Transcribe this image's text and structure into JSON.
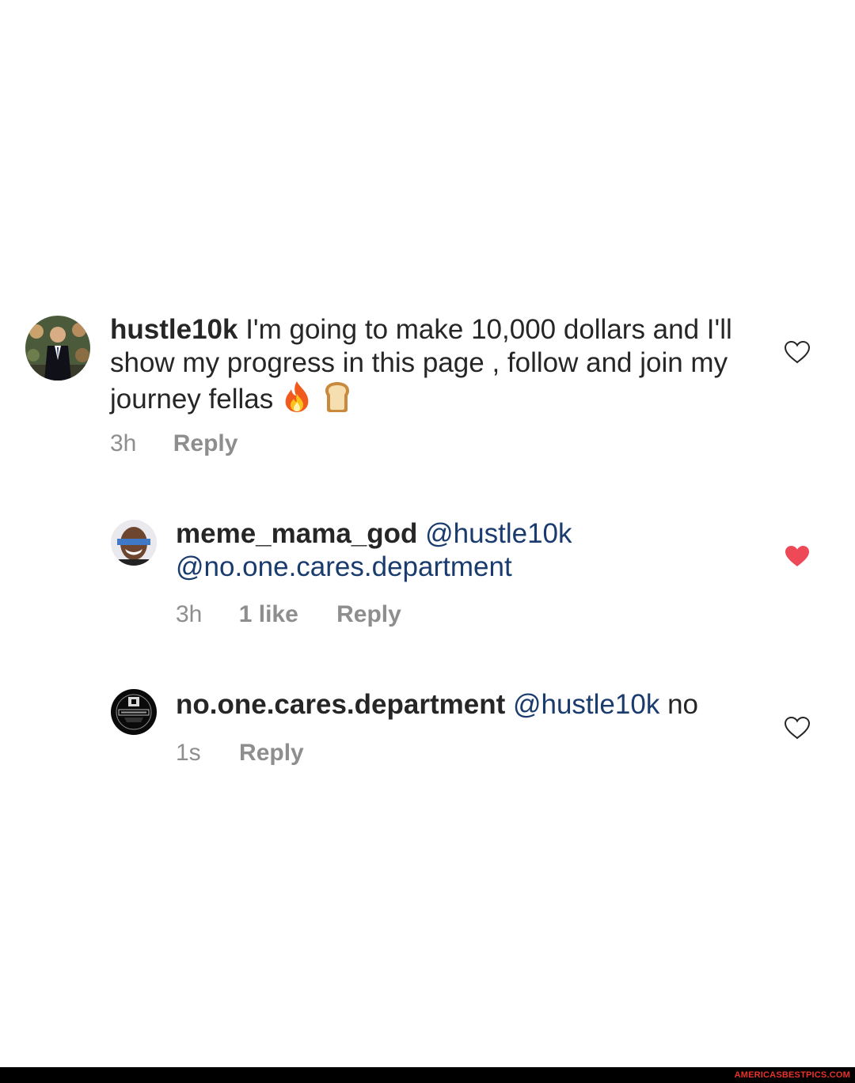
{
  "comments": [
    {
      "username": "hustle10k",
      "text": "I'm going to make 10,000 dollars and I'll show my progress in this page , follow and join my journey fellas",
      "emoji": [
        "fire-emoji",
        "bread-emoji"
      ],
      "time": "3h",
      "likes": "",
      "reply_label": "Reply",
      "liked": false
    },
    {
      "username": "meme_mama_god",
      "mention1": "@hustle10k",
      "mention2": "@no.one.cares.department",
      "time": "3h",
      "likes": "1 like",
      "reply_label": "Reply",
      "liked": true
    },
    {
      "username": "no.one.cares.department",
      "mention1": "@hustle10k",
      "text": "no",
      "time": "1s",
      "likes": "",
      "reply_label": "Reply",
      "liked": false
    }
  ],
  "colors": {
    "text": "#262626",
    "muted": "#8e8e8e",
    "mention": "#1a3b6e",
    "liked_heart": "#ed4956"
  },
  "footer": {
    "watermark": "AMERICASBESTPICS.COM"
  }
}
